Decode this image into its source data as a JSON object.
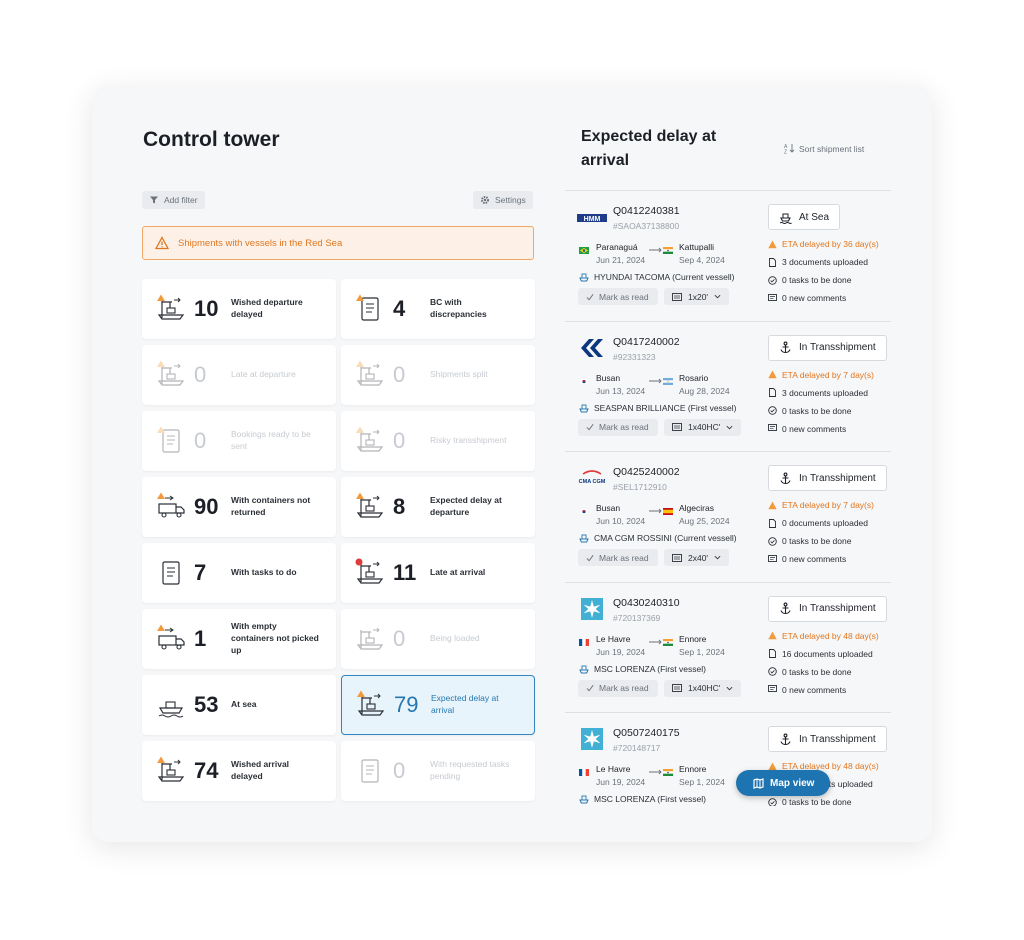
{
  "left": {
    "title": "Control tower",
    "add_filter": "Add filter",
    "settings": "Settings",
    "alert": "Shipments with vessels in the Red Sea",
    "cards": [
      {
        "count": "10",
        "label": "Wished departure delayed"
      },
      {
        "count": "4",
        "label": "BC with discrepancies"
      },
      {
        "count": "0",
        "label": "Late at departure"
      },
      {
        "count": "0",
        "label": "Shipments split"
      },
      {
        "count": "0",
        "label": "Bookings ready to be sent"
      },
      {
        "count": "0",
        "label": "Risky transshipment"
      },
      {
        "count": "90",
        "label": "With containers not returned"
      },
      {
        "count": "8",
        "label": "Expected delay at departure"
      },
      {
        "count": "7",
        "label": "With tasks to do"
      },
      {
        "count": "11",
        "label": "Late at arrival"
      },
      {
        "count": "1",
        "label": "With empty containers not picked up"
      },
      {
        "count": "0",
        "label": "Being loaded"
      },
      {
        "count": "53",
        "label": "At sea"
      },
      {
        "count": "79",
        "label": "Expected delay at arrival"
      },
      {
        "count": "74",
        "label": "Wished arrival delayed"
      },
      {
        "count": "0",
        "label": "With requested tasks pending"
      }
    ]
  },
  "right": {
    "title": "Expected delay at arrival",
    "sort": "Sort shipment list",
    "map_view": "Map view",
    "mark_as_read": "Mark as read",
    "shipments": [
      {
        "logo": "HMM",
        "id": "Q0412240381",
        "ref": "#SAOA37138800",
        "from_port": "Paranaguá",
        "from_date": "Jun 21, 2024",
        "to_port": "Kattupalli",
        "to_date": "Sep 4, 2024",
        "vessel": "HYUNDAI TACOMA (Current vessell)",
        "containers": "1x20'",
        "status": "At Sea",
        "eta": "ETA delayed by 36 day(s)",
        "docs": "3 documents uploaded",
        "tasks": "0 tasks to be done",
        "comments": "0 new comments"
      },
      {
        "logo": "Hapag",
        "id": "Q0417240002",
        "ref": "#92331323",
        "from_port": "Busan",
        "from_date": "Jun 13, 2024",
        "to_port": "Rosario",
        "to_date": "Aug 28, 2024",
        "vessel": "SEASPAN BRILLIANCE (First vessel)",
        "containers": "1x40HC'",
        "status": "In Transshipment",
        "eta": "ETA delayed by 7 day(s)",
        "docs": "3 documents uploaded",
        "tasks": "0 tasks to be done",
        "comments": "0 new comments"
      },
      {
        "logo": "CMA CGM",
        "id": "Q0425240002",
        "ref": "#SEL1712910",
        "from_port": "Busan",
        "from_date": "Jun 10, 2024",
        "to_port": "Algeciras",
        "to_date": "Aug 25, 2024",
        "vessel": "CMA CGM ROSSINI (Current vessell)",
        "containers": "2x40'",
        "status": "In Transshipment",
        "eta": "ETA delayed by 7 day(s)",
        "docs": "0 documents uploaded",
        "tasks": "0 tasks to be done",
        "comments": "0 new comments"
      },
      {
        "logo": "MSK",
        "id": "Q0430240310",
        "ref": "#720137369",
        "from_port": "Le Havre",
        "from_date": "Jun 19, 2024",
        "to_port": "Ennore",
        "to_date": "Sep 1, 2024",
        "vessel": "MSC LORENZA (First vessel)",
        "containers": "1x40HC'",
        "status": "In Transshipment",
        "eta": "ETA delayed by 48 day(s)",
        "docs": "16 documents uploaded",
        "tasks": "0 tasks to be done",
        "comments": "0 new comments"
      },
      {
        "logo": "MSK",
        "id": "Q0507240175",
        "ref": "#720148717",
        "from_port": "Le Havre",
        "from_date": "Jun 19, 2024",
        "to_port": "Ennore",
        "to_date": "Sep 1, 2024",
        "vessel": "MSC LORENZA (First vessel)",
        "containers": "",
        "status": "In Transshipment",
        "eta": "ETA delayed by 48 day(s)",
        "docs": "16 documents uploaded",
        "tasks": "0 tasks to be done",
        "comments": ""
      }
    ]
  },
  "colors": {
    "accent": "#1e73b1",
    "warning": "#e1761f",
    "alert_bg": "#fdf1e7"
  }
}
